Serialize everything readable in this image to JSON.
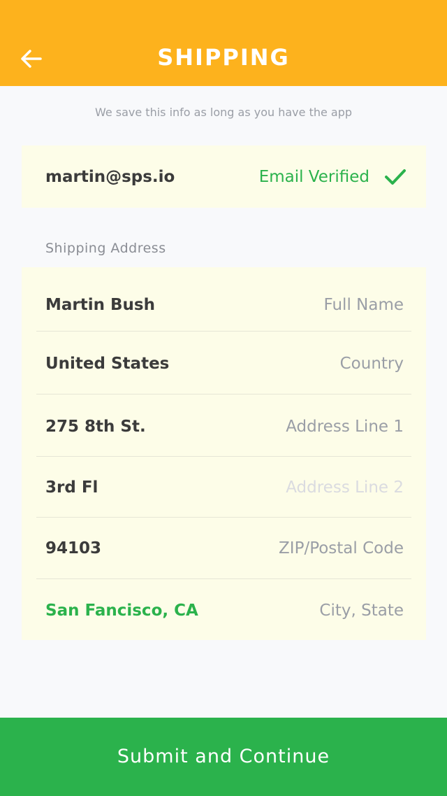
{
  "colors": {
    "header": "#fdb21d",
    "accent_green": "#2bb24c",
    "card_bg": "#fdfde8",
    "page_bg": "#f8f9fb"
  },
  "header": {
    "back_icon": "arrow-left-icon",
    "title": "SHIPPING"
  },
  "subtitle": "We save this info as long as you have the app",
  "email": {
    "value": "martin@sps.io",
    "status": "Email Verified",
    "status_icon": "checkmark-icon"
  },
  "shipping": {
    "section_label": "Shipping Address",
    "fields": [
      {
        "value": "Martin Bush",
        "label": "Full Name"
      },
      {
        "value": "United States",
        "label": "Country"
      },
      {
        "value": "275 8th St.",
        "label": "Address Line 1"
      },
      {
        "value": "3rd Fl",
        "label": "Address Line 2"
      },
      {
        "value": "94103",
        "label": "ZIP/Postal Code"
      },
      {
        "value": "San Fancisco, CA",
        "label": "City, State"
      }
    ]
  },
  "submit_label": "Submit and Continue"
}
